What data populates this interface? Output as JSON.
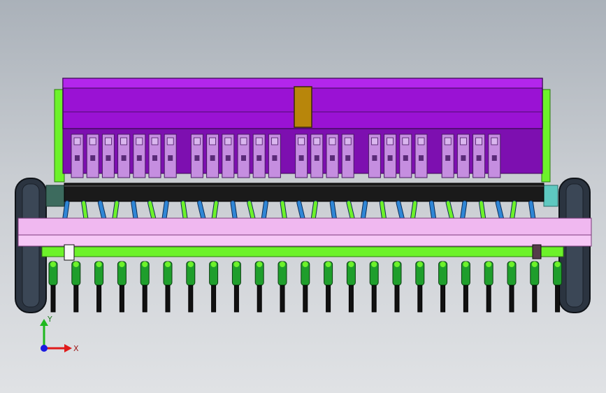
{
  "viewport": {
    "background_top": "#aab1b9",
    "background_bottom": "#e0e2e5"
  },
  "model": {
    "hopper_color": "#9a12d4",
    "hopper_dark": "#7d0fb0",
    "metering_unit_color": "#c58ee0",
    "frame_color": "#f0b8f0",
    "bar_color": "#1a1a1a",
    "tube_color": "#2f86d6",
    "green_color": "#6df22a",
    "tire_color": "#2b3440",
    "lid_color": "#b8860b",
    "unit_groups": [
      7,
      6,
      4,
      4,
      4
    ],
    "opener_count": 23
  },
  "triad": {
    "x_label": "X",
    "y_label": "Y",
    "x_color": "#e01b1b",
    "y_color": "#1fb81f",
    "z_color": "#1b1be0"
  }
}
